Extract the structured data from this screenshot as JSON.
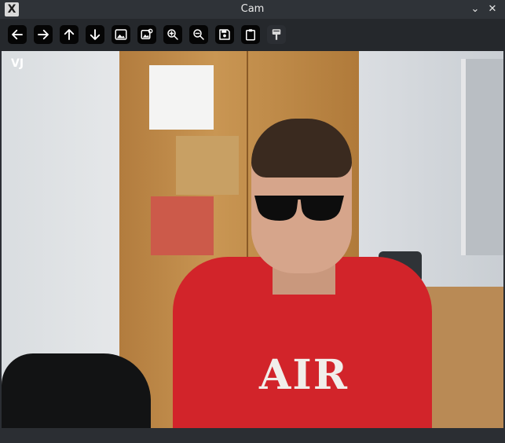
{
  "window": {
    "title": "Cam",
    "minimize_glyph": "⌄",
    "close_glyph": "✕"
  },
  "toolbar": {
    "buttons": [
      {
        "name": "arrow-left-icon"
      },
      {
        "name": "arrow-right-icon"
      },
      {
        "name": "arrow-up-icon"
      },
      {
        "name": "arrow-down-icon"
      },
      {
        "name": "image-icon"
      },
      {
        "name": "image-settings-icon"
      },
      {
        "name": "zoom-in-icon"
      },
      {
        "name": "zoom-out-icon"
      },
      {
        "name": "save-icon"
      },
      {
        "name": "clipboard-icon"
      },
      {
        "name": "paint-brush-icon"
      }
    ]
  },
  "video": {
    "watermark": "VJ",
    "shirt_text": "AIR"
  }
}
